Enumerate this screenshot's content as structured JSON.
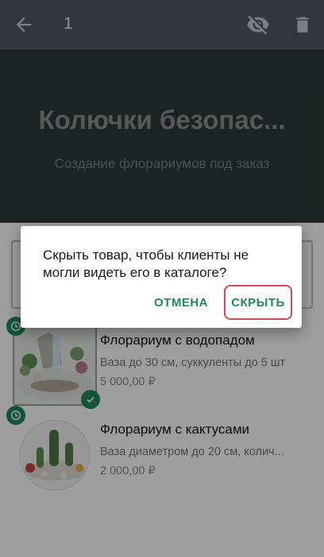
{
  "appbar": {
    "selected_count": "1",
    "back_icon": "arrow-left-icon",
    "hide_icon": "eye-off-icon",
    "delete_icon": "trash-icon"
  },
  "banner": {
    "title": "Колючки безопас...",
    "subtitle": "Создание флорариумов под заказ"
  },
  "products": [
    {
      "name": "Флорариум с водопадом",
      "description": "Ваза до 30 см, суккуленты до 5 шт",
      "price": "5 000,00 ₽",
      "selected": true
    },
    {
      "name": "Флорариум с кактусами",
      "description": "Ваза диаметром до 20 см, колич...",
      "price": "2 000,00 ₽",
      "selected": false
    }
  ],
  "dialog": {
    "message": "Скрыть товар, чтобы клиенты не могли видеть его в каталоге?",
    "cancel_label": "ОТМЕНА",
    "confirm_label": "СКРЫТЬ"
  },
  "colors": {
    "accent": "#1e8a5a",
    "appbar": "#54595e",
    "banner": "#2b3b37",
    "highlight_border": "#d4485c"
  }
}
